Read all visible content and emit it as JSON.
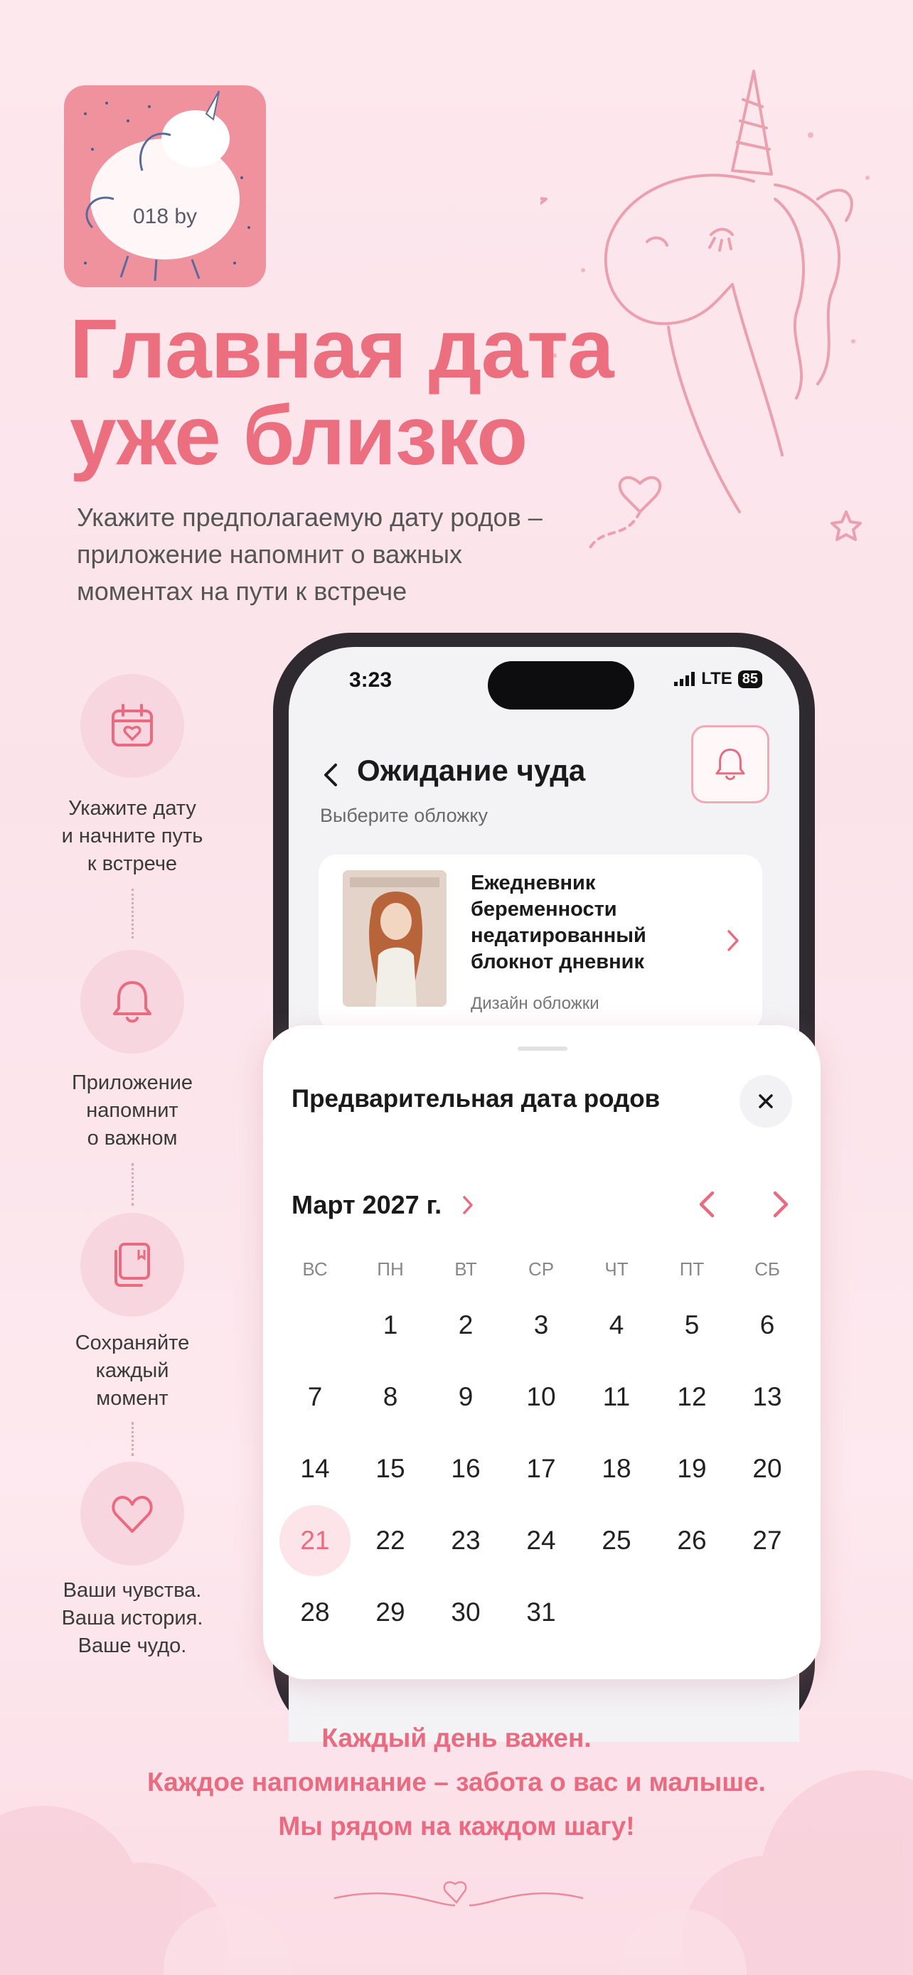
{
  "logo": {
    "text": "018 by"
  },
  "headline": {
    "line1": "Главная дата",
    "line2": "уже близко"
  },
  "subtitle": {
    "line1": "Укажите предполагаемую дату родов –",
    "line2": "приложение напомнит о важных",
    "line3": "моментах на пути к встрече"
  },
  "steps": [
    {
      "icon": "calendar-heart-icon",
      "lines": [
        "Укажите дату",
        "и начните путь",
        "к встрече"
      ]
    },
    {
      "icon": "bell-icon",
      "lines": [
        "Приложение",
        "напомнит",
        "о важном"
      ]
    },
    {
      "icon": "notebook-icon",
      "lines": [
        "Сохраняйте",
        "каждый",
        "момент"
      ]
    },
    {
      "icon": "heart-icon",
      "lines": [
        "Ваши чувства.",
        "Ваша история.",
        "Ваше чудо."
      ]
    }
  ],
  "phone": {
    "status_time": "3:23",
    "network": "LTE",
    "battery": "85",
    "screen_title": "Ожидание чуда",
    "cover_label": "Выберите обложку",
    "cover_card": {
      "title_lines": [
        "Ежедневник",
        "беременности",
        "недатированный",
        "блокнот дневник"
      ],
      "subtitle": "Дизайн обложки"
    }
  },
  "sheet": {
    "title": "Предварительная дата родов",
    "month": "Март 2027 г.",
    "weekdays": [
      "ВС",
      "ПН",
      "ВТ",
      "СР",
      "ЧТ",
      "ПТ",
      "СБ"
    ],
    "weeks": [
      [
        "",
        "1",
        "2",
        "3",
        "4",
        "5",
        "6"
      ],
      [
        "7",
        "8",
        "9",
        "10",
        "11",
        "12",
        "13"
      ],
      [
        "14",
        "15",
        "16",
        "17",
        "18",
        "19",
        "20"
      ],
      [
        "21",
        "22",
        "23",
        "24",
        "25",
        "26",
        "27"
      ],
      [
        "28",
        "29",
        "30",
        "31",
        "",
        "",
        ""
      ]
    ],
    "selected_day": "21"
  },
  "caption": {
    "line1": "Каждый день важен.",
    "line2": "Каждое напоминание – забота о вас и малыше.",
    "line3": "Мы рядом на каждом шагу!"
  },
  "colors": {
    "accent": "#ea6a80",
    "logo_bg": "#f0929d",
    "background": "#fde8ee"
  }
}
